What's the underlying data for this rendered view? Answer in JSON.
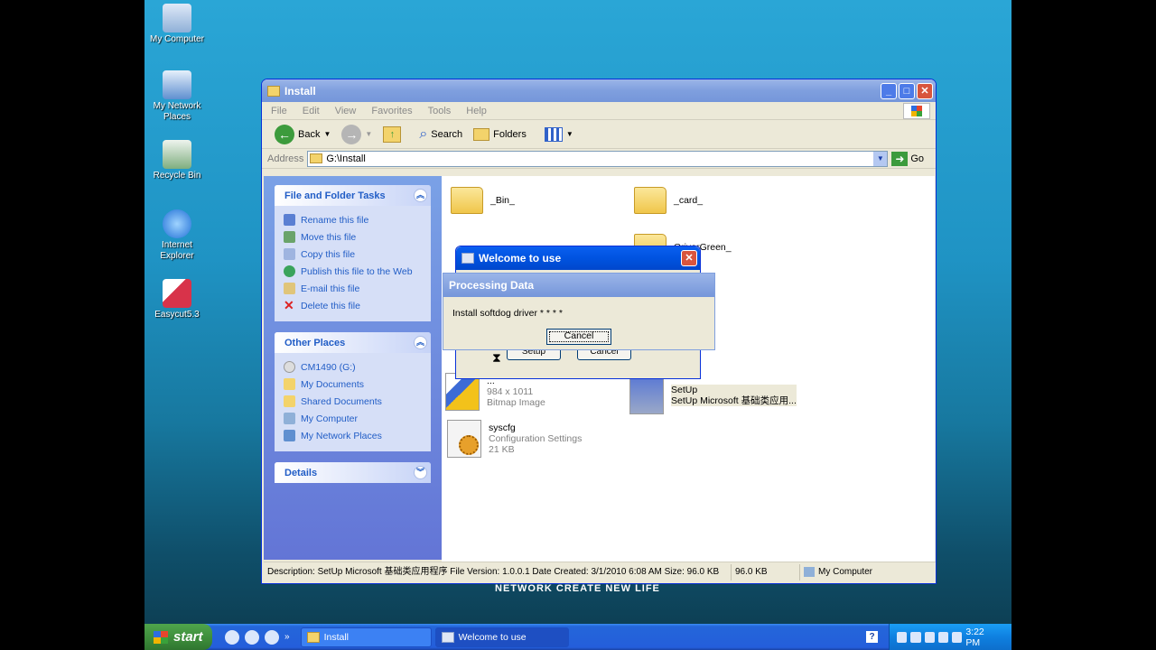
{
  "desktop": {
    "icons": [
      {
        "label": "My Computer"
      },
      {
        "label": "My Network Places"
      },
      {
        "label": "Recycle Bin"
      },
      {
        "label": "Internet Explorer"
      },
      {
        "label": "Easycut5.3"
      }
    ],
    "tagline": "NETWORK CREATE NEW LIFE"
  },
  "explorer": {
    "title": "Install",
    "menu": [
      "File",
      "Edit",
      "View",
      "Favorites",
      "Tools",
      "Help"
    ],
    "toolbar": {
      "back": "Back",
      "search": "Search",
      "folders": "Folders"
    },
    "address": {
      "label": "Address",
      "value": "G:\\Install",
      "go": "Go"
    },
    "tasks": {
      "title": "File and Folder Tasks",
      "items": [
        "Rename this file",
        "Move this file",
        "Copy this file",
        "Publish this file to the Web",
        "E-mail this file",
        "Delete this file"
      ]
    },
    "other_places": {
      "title": "Other Places",
      "items": [
        "CM1490 (G:)",
        "My Documents",
        "Shared Documents",
        "My Computer",
        "My Network Places"
      ]
    },
    "details": {
      "title": "Details"
    },
    "files": {
      "bin": {
        "name": "_Bin_"
      },
      "card": {
        "name": "_card_"
      },
      "driver_green": {
        "name": "OriverGreen_"
      },
      "image": {
        "name": "...",
        "dims": "984 x 1011",
        "type": "Bitmap Image"
      },
      "setup": {
        "name": "SetUp",
        "desc": "SetUp Microsoft 基础类应用..."
      },
      "syscfg": {
        "name": "syscfg",
        "type": "Configuration Settings",
        "size": "21 KB"
      }
    },
    "status": {
      "description": "Description: SetUp Microsoft 基础类应用程序 File Version: 1.0.0.1 Date Created: 3/1/2010 6:08 AM Size: 96.0 KB",
      "size": "96.0 KB",
      "location": "My Computer"
    }
  },
  "welcome_dialog": {
    "title": "Welcome to use",
    "setup_label": "Setup",
    "cancel_label": "Cancel"
  },
  "processing_dialog": {
    "title": "Processing Data",
    "message": "Install softdog driver * * * *",
    "cancel_label": "Cancel"
  },
  "taskbar": {
    "start": "start",
    "tasks": [
      {
        "label": "Install"
      },
      {
        "label": "Welcome to use"
      }
    ],
    "help": "?",
    "clock": "3:22 PM"
  }
}
